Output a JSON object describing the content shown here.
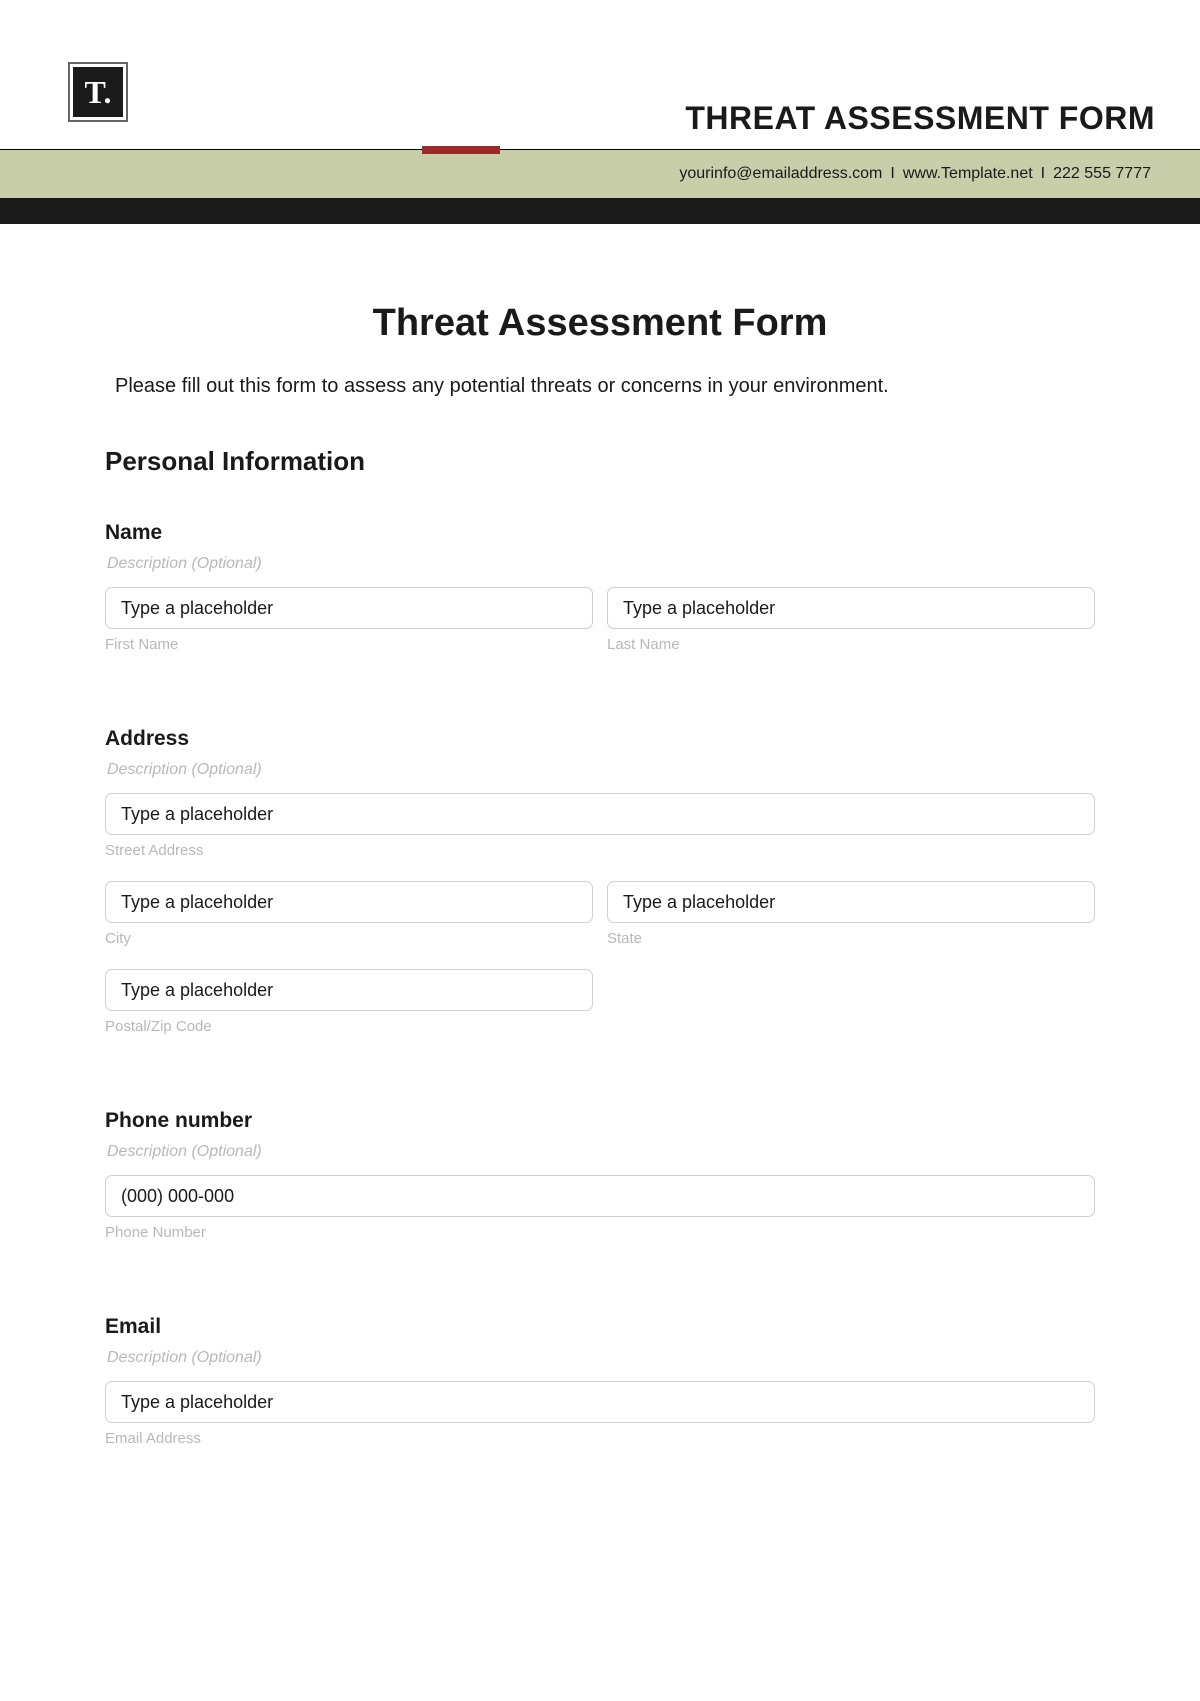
{
  "header": {
    "logo_text": "T.",
    "title": "THREAT ASSESSMENT FORM",
    "email": "yourinfo@emailaddress.com",
    "website": "www.Template.net",
    "phone": "222 555 7777",
    "separator": "I"
  },
  "main": {
    "title": "Threat Assessment Form",
    "intro": "Please fill out this form to assess any potential threats or concerns in your environment."
  },
  "section": {
    "personal_info": "Personal Information"
  },
  "fields": {
    "name": {
      "label": "Name",
      "desc": "Description (Optional)",
      "first_placeholder": "Type a placeholder",
      "first_sublabel": "First Name",
      "last_placeholder": "Type a placeholder",
      "last_sublabel": "Last Name"
    },
    "address": {
      "label": "Address",
      "desc": "Description (Optional)",
      "street_placeholder": "Type a placeholder",
      "street_sublabel": "Street Address",
      "city_placeholder": "Type a placeholder",
      "city_sublabel": "City",
      "state_placeholder": "Type a placeholder",
      "state_sublabel": "State",
      "zip_placeholder": "Type a placeholder",
      "zip_sublabel": "Postal/Zip Code"
    },
    "phone": {
      "label": "Phone number",
      "desc": "Description (Optional)",
      "placeholder": "(000) 000-000",
      "sublabel": "Phone Number"
    },
    "email": {
      "label": "Email",
      "desc": "Description (Optional)",
      "placeholder": "Type a placeholder",
      "sublabel": "Email Address"
    }
  }
}
